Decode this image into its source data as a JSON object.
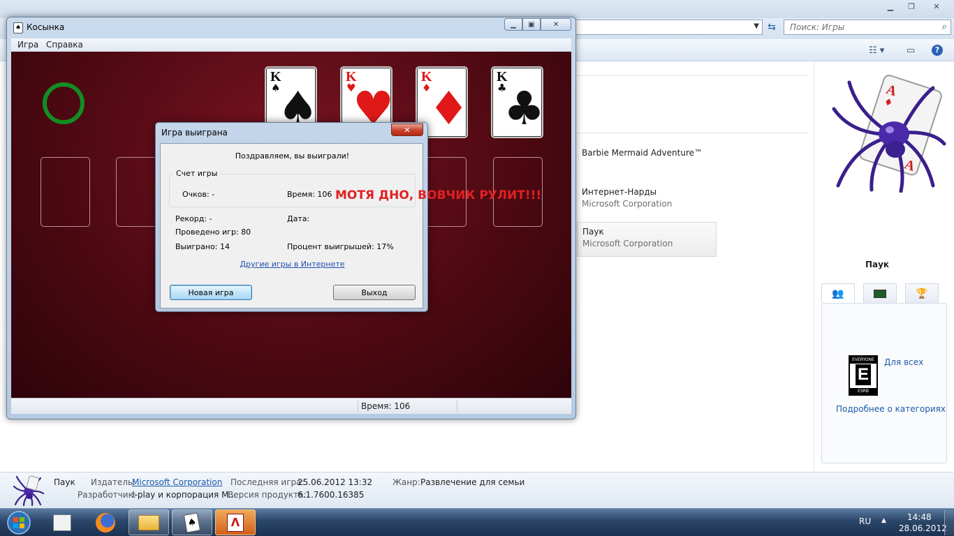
{
  "explorer": {
    "search": {
      "placeholder": "Поиск: Игры"
    },
    "games": [
      {
        "name": "Barbie Mermaid Adventure™",
        "publisher": ""
      },
      {
        "name": "Интернет-Нарды",
        "publisher": "Microsoft Corporation"
      },
      {
        "name": "Паук",
        "publisher": "Microsoft Corporation"
      }
    ],
    "preview": {
      "title": "Паук",
      "rating_label": "Для всех",
      "rating_more": "Подробнее о категориях",
      "esrb": {
        "top": "EVERYONE",
        "letter": "E",
        "bottom": "ESRB"
      }
    },
    "details": {
      "name": "Паук",
      "publisher_label": "Издатель:",
      "publisher": "Microsoft Corporation",
      "last_played_label": "Последняя игра:",
      "last_played": "25.06.2012 13:32",
      "genre_label": "Жанр:",
      "genre": "Развлечение для семьи",
      "developer_label": "Разработчик:",
      "developer": "I-play и корпорация M...",
      "version_label": "Версия продукта:",
      "version": "6.1.7600.16385"
    }
  },
  "solitaire": {
    "title": "Косынка",
    "menu": [
      "Игра",
      "Справка"
    ],
    "foundations": [
      {
        "rank": "K",
        "suit": "♠",
        "color": "black"
      },
      {
        "rank": "K",
        "suit": "♥",
        "color": "red"
      },
      {
        "rank": "K",
        "suit": "♦",
        "color": "red"
      },
      {
        "rank": "K",
        "suit": "♣",
        "color": "black"
      }
    ],
    "status": {
      "time": "Время:  106"
    }
  },
  "dialog": {
    "title": "Игра выиграна",
    "message": "Поздравляем, вы выиграли!",
    "group_label": "Счет игры",
    "points": "Очков: -",
    "time": "Время:  106",
    "record": "Рекорд: -",
    "date": "Дата:",
    "games_played": "Проведено игр: 80",
    "games_won": "Выиграно: 14",
    "win_percent": "Процент выигрышей: 17%",
    "link": "Другие игры в Интернете",
    "new_game": "Новая игра",
    "exit": "Выход"
  },
  "overlay_text": "МОТЯ ДНО, ВОВЧИК РУЛИТ!!!",
  "taskbar": {
    "lang": "RU",
    "time": "14:48",
    "date": "28.06.2012"
  },
  "colors": {
    "felt": "#4e0912",
    "overlay": "#e02222",
    "link": "#1e5aa8"
  }
}
